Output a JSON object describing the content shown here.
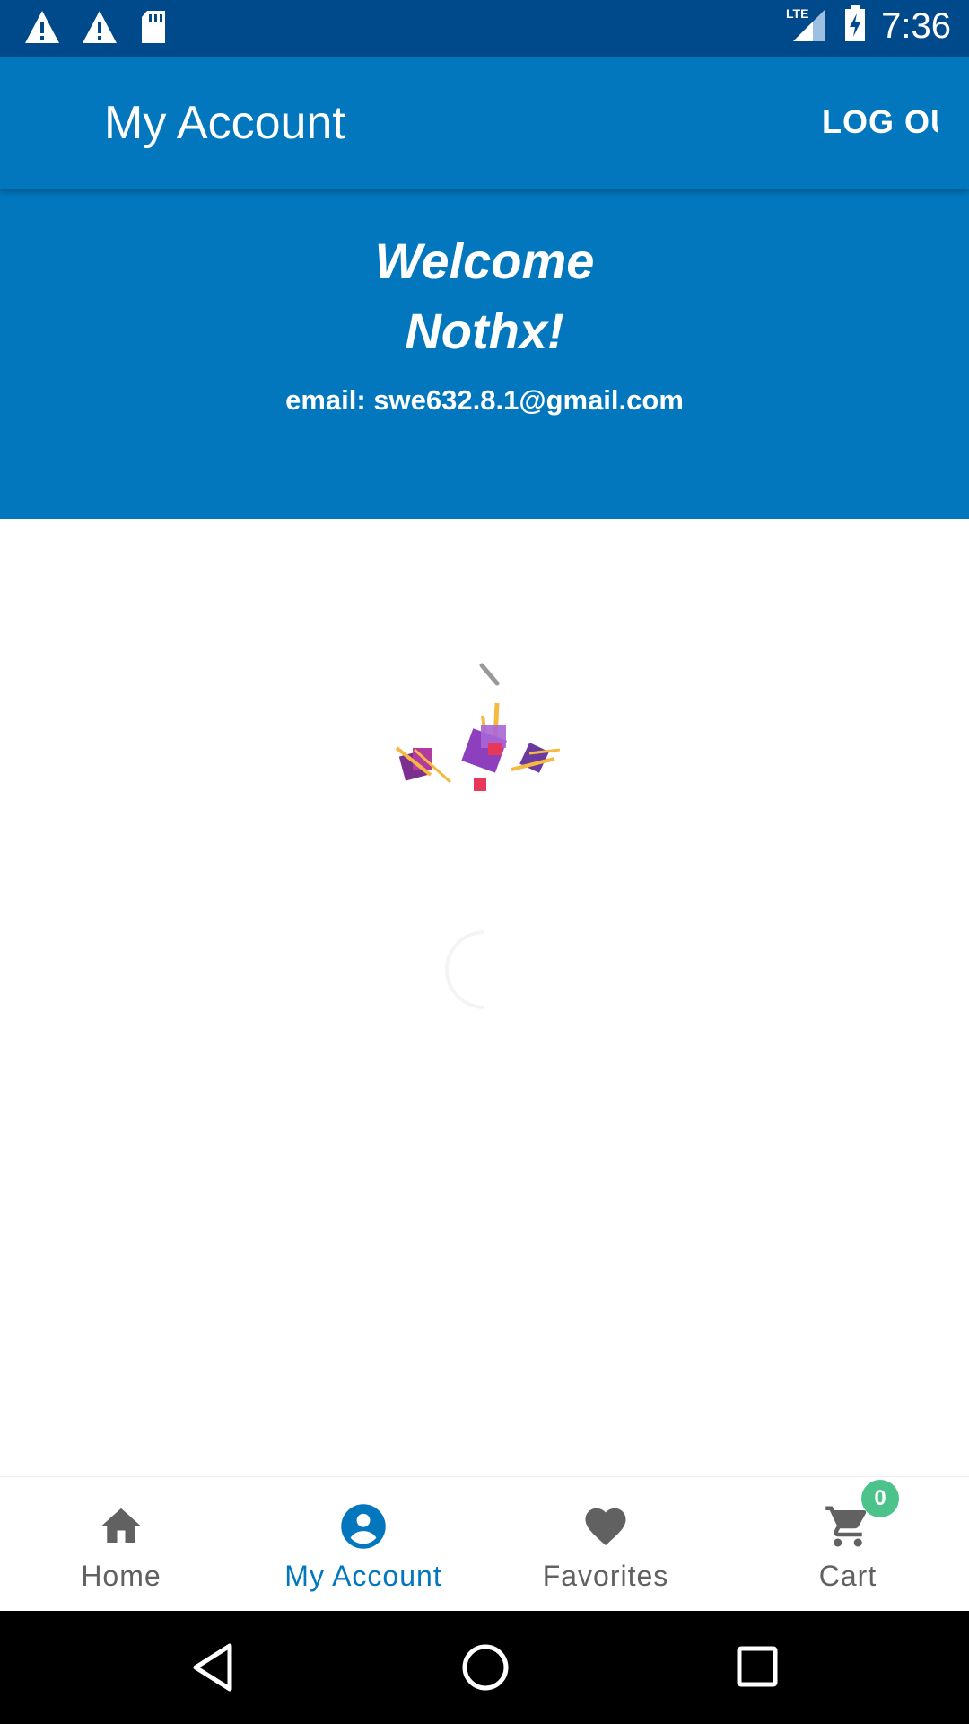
{
  "status_bar": {
    "time": "7:36",
    "icons": [
      "warning-icon",
      "warning-icon",
      "sd-card-icon",
      "lte-signal-icon",
      "battery-charging-icon"
    ]
  },
  "app_bar": {
    "title": "My Account",
    "logout_label": "LOG OUT"
  },
  "welcome": {
    "greeting": "Welcome",
    "name": "Nothx!",
    "email": "email: swe632.8.1@gmail.com"
  },
  "bottom_nav": {
    "items": [
      {
        "label": "Home",
        "icon": "home-icon"
      },
      {
        "label": "My Account",
        "icon": "account-circle-icon"
      },
      {
        "label": "Favorites",
        "icon": "heart-icon"
      },
      {
        "label": "Cart",
        "icon": "cart-icon"
      }
    ],
    "cart_badge": "0",
    "active_index": 1
  },
  "colors": {
    "primary": "#0277bd",
    "status_bar": "#004a8c",
    "badge": "#4cc38a",
    "inactive": "#616161"
  }
}
